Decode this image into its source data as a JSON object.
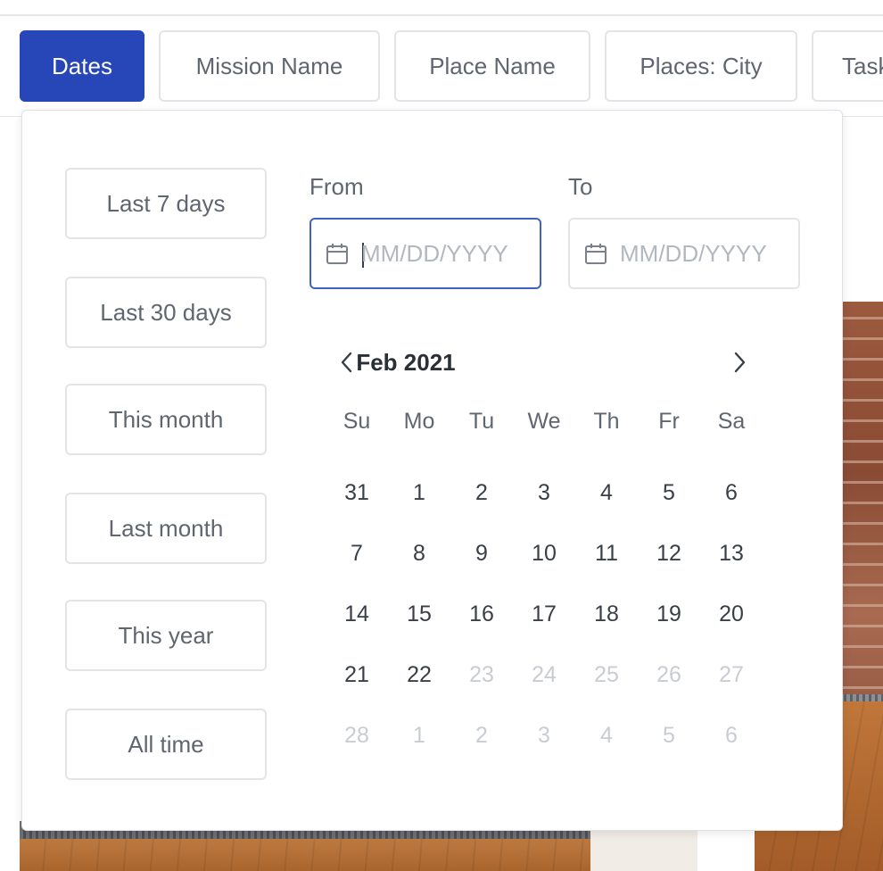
{
  "filter_tabs": [
    {
      "label": "Dates",
      "active": true
    },
    {
      "label": "Mission Name",
      "active": false
    },
    {
      "label": "Place Name",
      "active": false
    },
    {
      "label": "Places: City",
      "active": false
    },
    {
      "label": "Task",
      "active": false
    }
  ],
  "date_panel": {
    "presets": [
      "Last 7 days",
      "Last 30 days",
      "This month",
      "Last month",
      "This year",
      "All time"
    ],
    "from": {
      "label": "From",
      "value": "",
      "placeholder": "MM/DD/YYYY"
    },
    "to": {
      "label": "To",
      "value": "",
      "placeholder": "MM/DD/YYYY"
    },
    "calendar": {
      "month_label": "Feb 2021",
      "prev_icon": "chevron-left-icon",
      "next_icon": "chevron-right-icon",
      "weekdays": [
        "Su",
        "Mo",
        "Tu",
        "We",
        "Th",
        "Fr",
        "Sa"
      ],
      "weeks": [
        [
          {
            "d": "31",
            "disabled": false
          },
          {
            "d": "1",
            "disabled": false
          },
          {
            "d": "2",
            "disabled": false
          },
          {
            "d": "3",
            "disabled": false
          },
          {
            "d": "4",
            "disabled": false
          },
          {
            "d": "5",
            "disabled": false
          },
          {
            "d": "6",
            "disabled": false
          }
        ],
        [
          {
            "d": "7",
            "disabled": false
          },
          {
            "d": "8",
            "disabled": false
          },
          {
            "d": "9",
            "disabled": false
          },
          {
            "d": "10",
            "disabled": false
          },
          {
            "d": "11",
            "disabled": false
          },
          {
            "d": "12",
            "disabled": false
          },
          {
            "d": "13",
            "disabled": false
          }
        ],
        [
          {
            "d": "14",
            "disabled": false
          },
          {
            "d": "15",
            "disabled": false
          },
          {
            "d": "16",
            "disabled": false
          },
          {
            "d": "17",
            "disabled": false
          },
          {
            "d": "18",
            "disabled": false
          },
          {
            "d": "19",
            "disabled": false
          },
          {
            "d": "20",
            "disabled": false
          }
        ],
        [
          {
            "d": "21",
            "disabled": false
          },
          {
            "d": "22",
            "disabled": false
          },
          {
            "d": "23",
            "disabled": true
          },
          {
            "d": "24",
            "disabled": true
          },
          {
            "d": "25",
            "disabled": true
          },
          {
            "d": "26",
            "disabled": true
          },
          {
            "d": "27",
            "disabled": true
          }
        ],
        [
          {
            "d": "28",
            "disabled": true
          },
          {
            "d": "1",
            "disabled": true
          },
          {
            "d": "2",
            "disabled": true
          },
          {
            "d": "3",
            "disabled": true
          },
          {
            "d": "4",
            "disabled": true
          },
          {
            "d": "5",
            "disabled": true
          },
          {
            "d": "6",
            "disabled": true
          }
        ]
      ]
    }
  },
  "colors": {
    "accent": "#2747b8",
    "focus_border": "#3f62c4",
    "text_muted": "#5f6670",
    "day_disabled": "#c9ccd1"
  }
}
